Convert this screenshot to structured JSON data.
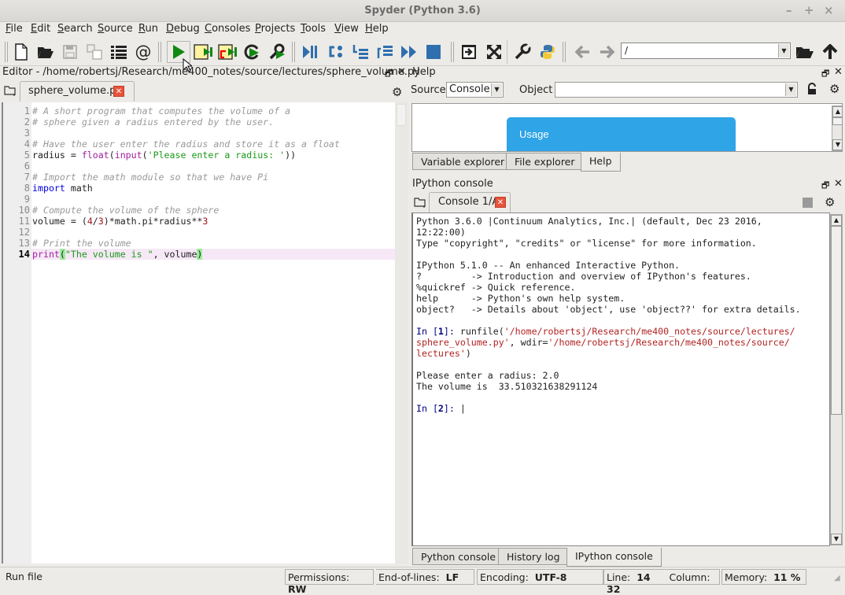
{
  "window": {
    "title": "Spyder (Python 3.6)"
  },
  "menu": [
    "File",
    "Edit",
    "Search",
    "Source",
    "Run",
    "Debug",
    "Consoles",
    "Projects",
    "Tools",
    "View",
    "Help"
  ],
  "toolbar": {
    "icons": [
      "new-file-icon",
      "open-file-icon",
      "save-icon",
      "save-all-icon",
      "outline-icon",
      "at-icon",
      "run-icon",
      "run-cell-icon",
      "run-cell-advance-icon",
      "rerun-icon",
      "run-config-icon",
      "debug-icon",
      "step-icon",
      "step-into-icon",
      "step-return-icon",
      "continue-icon",
      "stop-icon",
      "maximize-pane-icon",
      "fullscreen-icon",
      "preferences-icon",
      "python-path-icon",
      "back-icon",
      "forward-icon",
      "browse-folder-icon",
      "parent-dir-icon"
    ],
    "working_dir": "/"
  },
  "editor": {
    "title": "Editor - /home/robertsj/Research/me400_notes/source/lectures/sphere_volume.py",
    "tab": "sphere_volume.py",
    "current_line": 14,
    "lines": [
      {
        "n": "1",
        "segs": [
          {
            "c": "cmt",
            "t": "# A short program that computes the volume of a"
          }
        ]
      },
      {
        "n": "2",
        "segs": [
          {
            "c": "cmt",
            "t": "# sphere given a radius entered by the user."
          }
        ]
      },
      {
        "n": "3",
        "segs": []
      },
      {
        "n": "4",
        "segs": [
          {
            "c": "cmt",
            "t": "# Have the user enter the radius and store it as a float"
          }
        ]
      },
      {
        "n": "5",
        "segs": [
          {
            "c": "",
            "t": "radius = "
          },
          {
            "c": "kw",
            "t": "float"
          },
          {
            "c": "",
            "t": "("
          },
          {
            "c": "kw",
            "t": "input"
          },
          {
            "c": "",
            "t": "("
          },
          {
            "c": "str",
            "t": "'Please enter a radius: '"
          },
          {
            "c": "",
            "t": "))"
          }
        ]
      },
      {
        "n": "6",
        "segs": []
      },
      {
        "n": "7",
        "segs": [
          {
            "c": "cmt",
            "t": "# Import the math module so that we have Pi"
          }
        ]
      },
      {
        "n": "8",
        "segs": [
          {
            "c": "kw2",
            "t": "import"
          },
          {
            "c": "",
            "t": " math"
          }
        ]
      },
      {
        "n": "9",
        "segs": []
      },
      {
        "n": "10",
        "segs": [
          {
            "c": "cmt",
            "t": "# Compute the volume of the sphere"
          }
        ]
      },
      {
        "n": "11",
        "segs": [
          {
            "c": "",
            "t": "volume = ("
          },
          {
            "c": "num",
            "t": "4"
          },
          {
            "c": "",
            "t": "/"
          },
          {
            "c": "num",
            "t": "3"
          },
          {
            "c": "",
            "t": ")*math.pi*radius**"
          },
          {
            "c": "num",
            "t": "3"
          }
        ]
      },
      {
        "n": "12",
        "segs": []
      },
      {
        "n": "13",
        "segs": [
          {
            "c": "cmt",
            "t": "# Print the volume"
          }
        ]
      },
      {
        "n": "14",
        "segs": [
          {
            "c": "kw",
            "t": "print"
          },
          {
            "c": "bm",
            "t": "("
          },
          {
            "c": "str",
            "t": "\"The volume is \""
          },
          {
            "c": "",
            "t": ", volume"
          },
          {
            "c": "bm",
            "t": ")"
          }
        ]
      }
    ]
  },
  "help": {
    "title": "Help",
    "source_label": "Source",
    "source_value": "Console",
    "object_label": "Object",
    "object_value": "",
    "usage_heading": "Usage",
    "tabs": [
      "Variable explorer",
      "File explorer",
      "Help"
    ],
    "active_tab": "Help"
  },
  "ipython": {
    "title": "IPython console",
    "tab": "Console 1/A",
    "output": [
      [
        {
          "c": "",
          "t": "Python 3.6.0 |Continuum Analytics, Inc.| (default, Dec 23 2016,"
        }
      ],
      [
        {
          "c": "",
          "t": "12:22:00)"
        }
      ],
      [
        {
          "c": "",
          "t": "Type \"copyright\", \"credits\" or \"license\" for more information."
        }
      ],
      [],
      [
        {
          "c": "",
          "t": "IPython 5.1.0 -- An enhanced Interactive Python."
        }
      ],
      [
        {
          "c": "",
          "t": "?         -> Introduction and overview of IPython's features."
        }
      ],
      [
        {
          "c": "",
          "t": "%quickref -> Quick reference."
        }
      ],
      [
        {
          "c": "",
          "t": "help      -> Python's own help system."
        }
      ],
      [
        {
          "c": "",
          "t": "object?   -> Details about 'object', use 'object??' for extra details."
        }
      ],
      [],
      [
        {
          "c": "cin",
          "t": "In ["
        },
        {
          "c": "cinb",
          "t": "1"
        },
        {
          "c": "cin",
          "t": "]: "
        },
        {
          "c": "",
          "t": "runfile("
        },
        {
          "c": "red",
          "t": "'/home/robertsj/Research/me400_notes/source/lectures/"
        }
      ],
      [
        {
          "c": "red",
          "t": "sphere_volume.py'"
        },
        {
          "c": "",
          "t": ", wdir="
        },
        {
          "c": "red",
          "t": "'/home/robertsj/Research/me400_notes/source/"
        }
      ],
      [
        {
          "c": "red",
          "t": "lectures'"
        },
        {
          "c": "",
          "t": ")"
        }
      ],
      [],
      [
        {
          "c": "",
          "t": "Please enter a radius: 2.0"
        }
      ],
      [
        {
          "c": "",
          "t": "The volume is  33.510321638291124"
        }
      ],
      [],
      [
        {
          "c": "cin",
          "t": "In ["
        },
        {
          "c": "cinb",
          "t": "2"
        },
        {
          "c": "cin",
          "t": "]: "
        },
        {
          "c": "",
          "t": "|"
        }
      ]
    ],
    "bottom_tabs": [
      "Python console",
      "History log",
      "IPython console"
    ],
    "active_tab": "IPython console"
  },
  "status": {
    "message": "Run file",
    "permissions_label": "Permissions:",
    "permissions": "RW",
    "eol_label": "End-of-lines:",
    "eol": "LF",
    "encoding_label": "Encoding:",
    "encoding": "UTF-8",
    "line_label": "Line:",
    "line": "14",
    "column_label": "Column:",
    "column": "32",
    "memory_label": "Memory:",
    "memory": "11 %"
  }
}
